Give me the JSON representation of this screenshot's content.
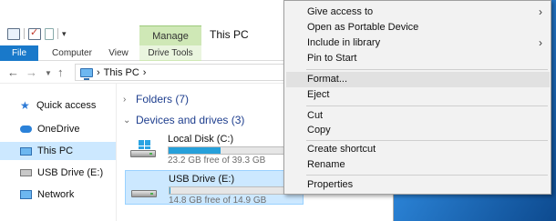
{
  "window": {
    "title": "This PC",
    "contextual_tab_group": "Manage",
    "ribbon_tabs": [
      "File",
      "Computer",
      "View",
      "Drive Tools"
    ]
  },
  "address_bar": {
    "path": "This PC",
    "separator_end": "›"
  },
  "sidebar": {
    "items": [
      {
        "label": "Quick access",
        "icon": "star-icon"
      },
      {
        "label": "OneDrive",
        "icon": "cloud-icon"
      },
      {
        "label": "This PC",
        "icon": "computer-icon",
        "selected": true
      },
      {
        "label": "USB Drive (E:)",
        "icon": "usb-drive-icon"
      },
      {
        "label": "Network",
        "icon": "network-icon"
      }
    ]
  },
  "content": {
    "folders_header": "Folders (7)",
    "devices_header": "Devices and drives (3)",
    "drives": [
      {
        "name": "Local Disk (C:)",
        "free_text": "23.2 GB free of 39.3 GB",
        "used_fraction": 0.41,
        "icon": "windows-drive-icon"
      },
      {
        "name": "USB Drive (E:)",
        "free_text": "14.8 GB free of 14.9 GB",
        "used_fraction": 0.01,
        "icon": "usb-drive-icon",
        "selected": true
      }
    ]
  },
  "context_menu": {
    "items": [
      {
        "label": "Give access to",
        "submenu": true
      },
      {
        "label": "Open as Portable Device"
      },
      {
        "label": "Include in library",
        "submenu": true
      },
      {
        "label": "Pin to Start"
      },
      {
        "label": "Format...",
        "highlighted": true
      },
      {
        "label": "Eject"
      },
      {
        "label": "Cut"
      },
      {
        "label": "Copy"
      },
      {
        "label": "Create shortcut"
      },
      {
        "label": "Rename"
      },
      {
        "label": "Properties"
      }
    ],
    "submenu_arrow": "›"
  },
  "colors": {
    "accent": "#1979ca",
    "selection": "#cce8ff",
    "contextual_tab": "#cfe8b6",
    "drive_bar_fill": "#26a0da"
  }
}
